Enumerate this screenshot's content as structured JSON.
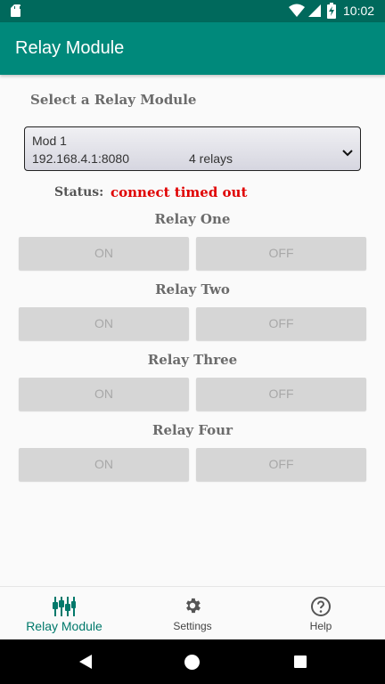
{
  "status_bar": {
    "time": "10:02"
  },
  "app_bar": {
    "title": "Relay Module"
  },
  "selector": {
    "label": "Select a Relay Module",
    "module_name": "Mod 1",
    "address": "192.168.4.1:8080",
    "relay_count": "4 relays"
  },
  "status": {
    "label": "Status:",
    "value": "connect timed out"
  },
  "relays": [
    {
      "title": "Relay One",
      "on_label": "ON",
      "off_label": "OFF"
    },
    {
      "title": "Relay Two",
      "on_label": "ON",
      "off_label": "OFF"
    },
    {
      "title": "Relay Three",
      "on_label": "ON",
      "off_label": "OFF"
    },
    {
      "title": "Relay Four",
      "on_label": "ON",
      "off_label": "OFF"
    }
  ],
  "bottom_nav": [
    {
      "label": "Relay Module",
      "icon": "relay-sliders-icon",
      "active": true
    },
    {
      "label": "Settings",
      "icon": "gear-icon",
      "active": false
    },
    {
      "label": "Help",
      "icon": "help-circle-icon",
      "active": false
    }
  ],
  "colors": {
    "primary": "#00897b",
    "primary_dark": "#00695c",
    "status_error": "#e00000",
    "nav_active": "#00796b"
  }
}
